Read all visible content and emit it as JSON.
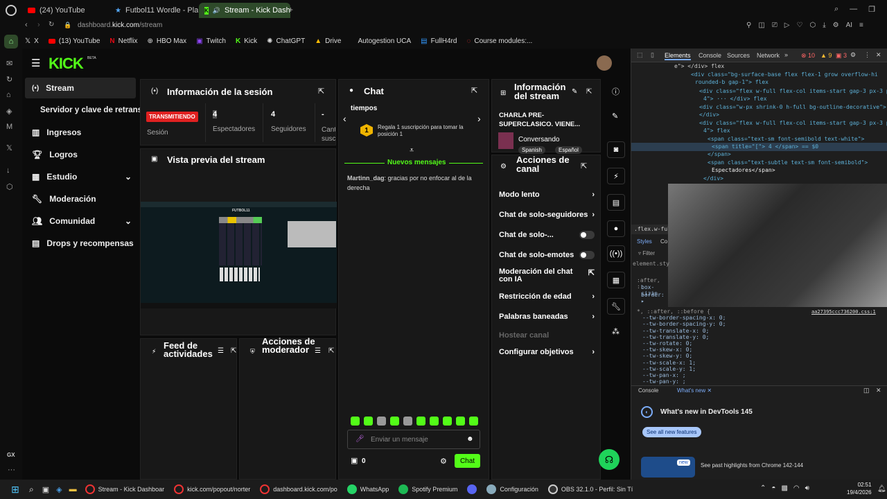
{
  "browser": {
    "tabs": [
      {
        "label": "(24) YouTube"
      },
      {
        "label": "Futbol11 Wordle - Play Foo"
      },
      {
        "label": "Stream - Kick Dashboa"
      }
    ],
    "address": {
      "prefix": "dashboard.",
      "domain": "kick.com",
      "path": "/stream"
    },
    "bookmarks": [
      "X",
      "(13) YouTube",
      "Netflix",
      "HBO Max",
      "Twitch",
      "Kick",
      "ChatGPT",
      "Drive",
      "Autogestion UCA",
      "FullH4rd",
      "Course modules:..."
    ],
    "ai_label": "AI"
  },
  "kick": {
    "logo": "KICK",
    "logo_beta": "BETA",
    "nav": [
      {
        "label": "Stream",
        "icon": "broadcast-icon",
        "active": true
      },
      {
        "label": "Servidor y clave de retransn",
        "icon": "",
        "active": false
      },
      {
        "label": "Ingresos",
        "icon": "chart-icon"
      },
      {
        "label": "Logros",
        "icon": "trophy-icon"
      },
      {
        "label": "Estudio",
        "icon": "grid-icon",
        "chevron": true
      },
      {
        "label": "Moderación",
        "icon": "wrench-icon"
      },
      {
        "label": "Comunidad",
        "icon": "people-icon",
        "chevron": true
      },
      {
        "label": "Drops y recompensas",
        "icon": "gift-icon"
      }
    ],
    "session": {
      "title": "Información de la sesión",
      "live_badge": "TRANSMITIENDO",
      "session_label": "Sesión",
      "viewers_value": "4",
      "viewers_label": "Espectadores",
      "followers_value": "4",
      "followers_label": "Seguidores",
      "subs_value": "-",
      "subs_label": "Cant susc"
    },
    "preview": {
      "title": "Vista previa del stream",
      "game_title": "FUTBOL11"
    },
    "activity": {
      "title": "Feed de actividades"
    },
    "modactions": {
      "title": "Acciones de moderador"
    },
    "chat": {
      "title": "Chat",
      "promo_partial": "tiempos",
      "promo_rank": "1",
      "promo_text": "Regala 1 suscripción para tomar la posición 1",
      "new_messages": "Nuevos mensajes",
      "messages": [
        {
          "user": "Martinn_dag",
          "text": ": gracias por no enfocar al de la derecha"
        }
      ],
      "input_placeholder": "Enviar un mensaje",
      "points": "0",
      "send_label": "Chat"
    },
    "stream_info": {
      "title": "Información del stream",
      "stream_title": "CHARLA PRE-SUPERCLASICO. VIENE...",
      "category": "Conversando",
      "tags": [
        "Spanish",
        "Español"
      ]
    },
    "channel_actions": {
      "title": "Acciones de canal",
      "items": [
        {
          "label": "Modo lento",
          "type": "chevron"
        },
        {
          "label": "Chat de solo-seguidores",
          "type": "chevron"
        },
        {
          "label": "Chat de solo-...",
          "type": "toggle"
        },
        {
          "label": "Chat de solo-emotes",
          "type": "toggle"
        },
        {
          "label": "Moderación del chat con IA",
          "type": "external"
        },
        {
          "label": "Restricción de edad",
          "type": "chevron"
        },
        {
          "label": "Palabras baneadas",
          "type": "chevron"
        },
        {
          "label": "Hostear canal",
          "type": "disabled"
        },
        {
          "label": "Configurar objetivos",
          "type": "chevron"
        }
      ]
    }
  },
  "devtools": {
    "tabs": [
      "Elements",
      "Console",
      "Sources",
      "Network"
    ],
    "errors": "10",
    "warnings": "9",
    "issues": "3",
    "lines": [
      "e\"> </div> flex",
      "<div class=\"bg-surface-base flex flex-1 grow overflow-hi",
      "rounded-b gap-1\"> flex",
      "<div class=\"flex w-full flex-col items-start gap-3 px-3 p",
      "4\"> ··· </div> flex",
      "<div class=\"w-px shrink-0 h-full bg-outline-decorative\">",
      "</div>",
      "<div class=\"flex w-full flex-col items-start gap-3 px-3 py-",
      "4\"> flex",
      "<span class=\"text-sm font-semibold text-white\">",
      "<span title=\"[\"> 4 </span> == $0",
      "</span>",
      "<span class=\"text-subtle text-sm font-semibold\">",
      "Espectadores</span>",
      "</div>"
    ],
    "breadcrumb": ".flex.w-full",
    "styles_tabs": [
      "Styles",
      "Co"
    ],
    "filter": "Filter",
    "element_style": "element.sty",
    "css_rules": [
      ":after, ::",
      "box-sizin",
      "border: ▸"
    ],
    "css_file": "aa27395ccc736200.css:1",
    "css_props": [
      "*, ::after, ::before {",
      "--tw-border-spacing-x: 0;",
      "--tw-border-spacing-y: 0;",
      "--tw-translate-x: 0;",
      "--tw-translate-y: 0;",
      "--tw-rotate: 0;",
      "--tw-skew-x: 0;",
      "--tw-skew-y: 0;",
      "--tw-scale-x: 1;",
      "--tw-scale-y: 1;",
      "--tw-pan-x: ;",
      "--tw-pan-y: ;"
    ],
    "drawer_tabs": [
      "Console",
      "What's new"
    ],
    "whats_new_title": "What's new in DevTools 145",
    "all_features": "See all new features",
    "highlights": "See past highlights from Chrome 142-144",
    "new_badge": "new"
  },
  "taskbar": {
    "items": [
      "Stream - Kick Dashboar",
      "kick.com/popout/norter",
      "dashboard.kick.com/po",
      "WhatsApp",
      "Spotify Premium",
      "",
      "Configuración",
      "OBS 32.1.0 - Perfil: Sin Tí"
    ],
    "time": "02:51",
    "date": "19/4/2026"
  },
  "os": {
    "gx_label": "GX"
  },
  "colors": {
    "accent": "#53fc18",
    "live": "#e02020",
    "devtools_bg": "#1e1e1e"
  }
}
